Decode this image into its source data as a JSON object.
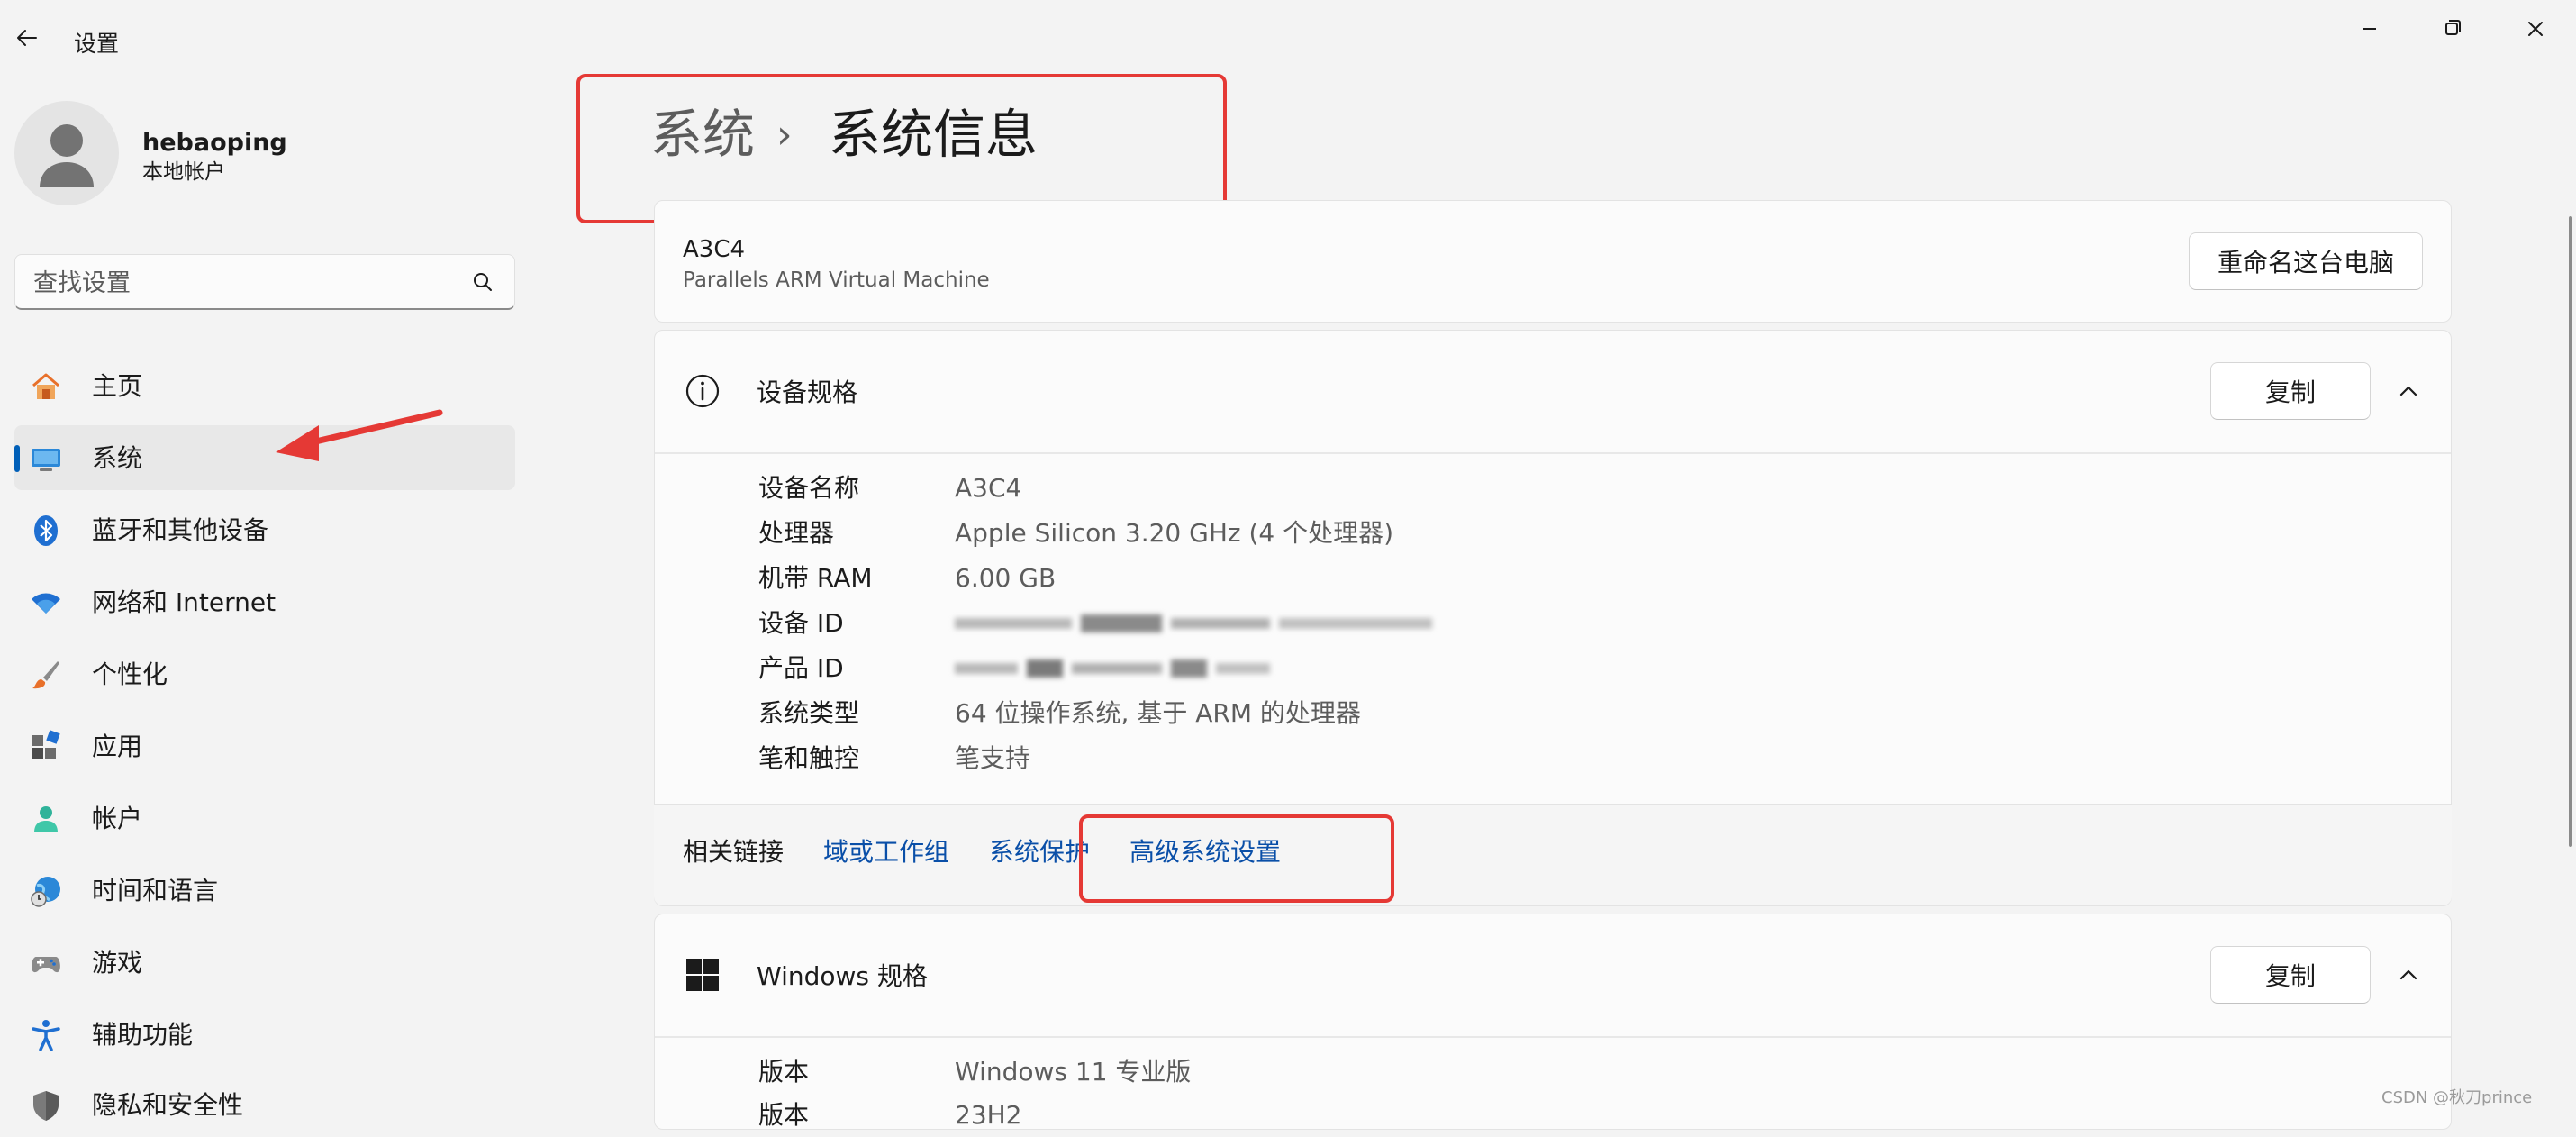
{
  "window": {
    "title": "设置",
    "controls": [
      "minimize-icon",
      "restore-icon",
      "close-icon"
    ]
  },
  "profile": {
    "name": "hebaoping",
    "account_type": "本地帐户"
  },
  "search": {
    "placeholder": "查找设置"
  },
  "sidebar": {
    "items": [
      {
        "label": "主页",
        "icon": "home-icon",
        "selected": false
      },
      {
        "label": "系统",
        "icon": "system-display-icon",
        "selected": true
      },
      {
        "label": "蓝牙和其他设备",
        "icon": "bluetooth-icon",
        "selected": false
      },
      {
        "label": "网络和 Internet",
        "icon": "wifi-icon",
        "selected": false
      },
      {
        "label": "个性化",
        "icon": "brush-icon",
        "selected": false
      },
      {
        "label": "应用",
        "icon": "apps-icon",
        "selected": false
      },
      {
        "label": "帐户",
        "icon": "account-icon",
        "selected": false
      },
      {
        "label": "时间和语言",
        "icon": "globe-clock-icon",
        "selected": false
      },
      {
        "label": "游戏",
        "icon": "gamepad-icon",
        "selected": false
      },
      {
        "label": "辅助功能",
        "icon": "accessibility-icon",
        "selected": false
      },
      {
        "label": "隐私和安全性",
        "icon": "shield-icon",
        "selected": false
      }
    ]
  },
  "breadcrumb": {
    "parent": "系统",
    "separator": "›",
    "current": "系统信息"
  },
  "pc_card": {
    "name": "A3C4",
    "model": "Parallels ARM Virtual Machine",
    "rename_button": "重命名这台电脑"
  },
  "device_specs": {
    "title": "设备规格",
    "copy_button": "复制",
    "rows": [
      {
        "label": "设备名称",
        "value": "A3C4",
        "obscured": false
      },
      {
        "label": "处理器",
        "value": "Apple Silicon   3.20 GHz  (4 个处理器)",
        "obscured": false
      },
      {
        "label": "机带 RAM",
        "value": "6.00 GB",
        "obscured": false
      },
      {
        "label": "设备 ID",
        "value": "",
        "obscured": true
      },
      {
        "label": "产品 ID",
        "value": "",
        "obscured": true
      },
      {
        "label": "系统类型",
        "value": "64 位操作系统, 基于 ARM 的处理器",
        "obscured": false
      },
      {
        "label": "笔和触控",
        "value": "笔支持",
        "obscured": false
      }
    ]
  },
  "related_links": {
    "label": "相关链接",
    "links": [
      "域或工作组",
      "系统保护",
      "高级系统设置"
    ]
  },
  "windows_specs": {
    "title": "Windows 规格",
    "copy_button": "复制",
    "rows": [
      {
        "label": "版本",
        "value": "Windows 11 专业版"
      },
      {
        "label": "版本",
        "value": "23H2"
      }
    ]
  },
  "watermark": "CSDN @秋刀prince",
  "colors": {
    "accent": "#005fb8",
    "link": "#0a4fa8",
    "annotation_red": "#e53935",
    "background": "#f3f3f3",
    "card": "#fbfbfb"
  }
}
